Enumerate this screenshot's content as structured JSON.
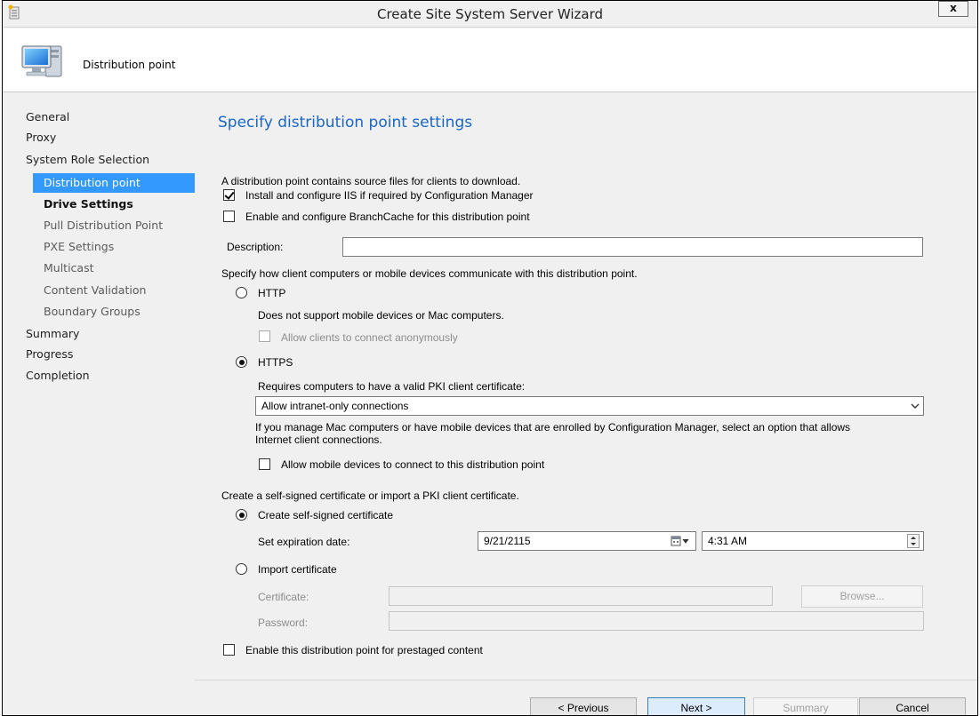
{
  "window": {
    "title": "Create Site System Server Wizard",
    "close_label": "x"
  },
  "header": {
    "title": "Distribution point"
  },
  "nav": {
    "items": [
      {
        "label": "General"
      },
      {
        "label": "Proxy"
      },
      {
        "label": "System Role Selection"
      },
      {
        "label": "Distribution point"
      },
      {
        "label": "Drive Settings"
      },
      {
        "label": "Pull Distribution Point"
      },
      {
        "label": "PXE Settings"
      },
      {
        "label": "Multicast"
      },
      {
        "label": "Content Validation"
      },
      {
        "label": "Boundary Groups"
      },
      {
        "label": "Summary"
      },
      {
        "label": "Progress"
      },
      {
        "label": "Completion"
      }
    ],
    "selected": "Distribution point"
  },
  "content": {
    "heading": "Specify distribution point settings",
    "intro": "A distribution point contains source files for clients to download.",
    "iis_checkbox": {
      "label": "Install and configure IIS if required by Configuration Manager",
      "checked": true
    },
    "branchcache_checkbox": {
      "label": "Enable and configure BranchCache for this distribution point",
      "checked": false
    },
    "description": {
      "label": "Description:",
      "value": ""
    },
    "communicate_label": "Specify how client computers or mobile devices communicate with this distribution point.",
    "http": {
      "label": "HTTP",
      "selected": false,
      "note": "Does not support mobile devices or Mac computers.",
      "anonymous_checkbox": {
        "label": "Allow clients to connect anonymously",
        "checked": false,
        "enabled": false
      }
    },
    "https": {
      "label": "HTTPS",
      "selected": true,
      "note": "Requires computers to have a valid PKI client certificate:",
      "connection_select": {
        "value": "Allow intranet-only connections"
      },
      "mac_note_line1": "If you manage Mac computers or have mobile devices that are enrolled by Configuration Manager, select an option that allows",
      "mac_note_line2": "Internet client connections.",
      "mobile_checkbox": {
        "label": "Allow mobile devices to connect to this distribution point",
        "checked": false
      }
    },
    "certificate_label": "Create a self-signed certificate or import a PKI client certificate.",
    "self_signed": {
      "label": "Create self-signed certificate",
      "selected": true,
      "expiration_label": "Set expiration date:",
      "date_value": "9/21/2115",
      "time_value": "4:31 AM"
    },
    "import": {
      "label": "Import certificate",
      "selected": false,
      "certificate_label": "Certificate:",
      "password_label": "Password:",
      "browse_label": "Browse..."
    },
    "prestaged_checkbox": {
      "label": "Enable this distribution point for prestaged content",
      "checked": false
    }
  },
  "buttons": {
    "previous": "< Previous",
    "next": "Next >",
    "summary": "Summary",
    "cancel": "Cancel"
  },
  "colors": {
    "heading": "#1a66c4",
    "selection": "#3399ff"
  }
}
